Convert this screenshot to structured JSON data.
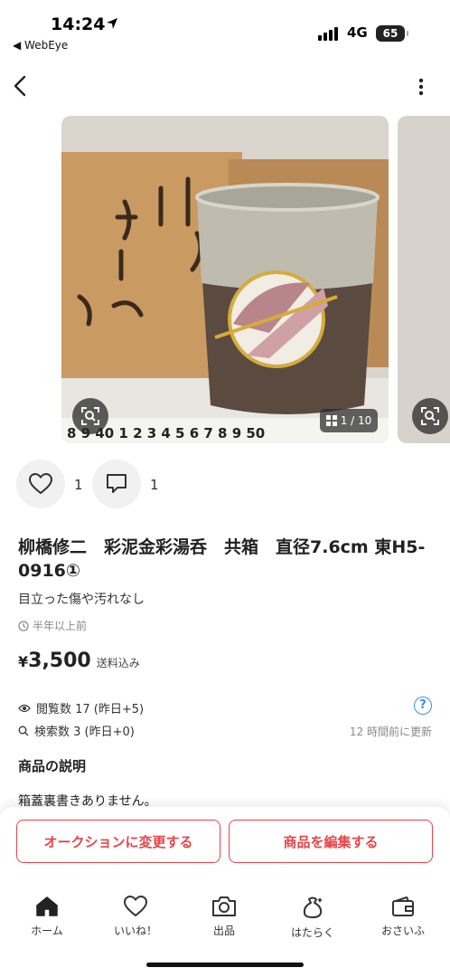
{
  "status_bar": {
    "time": "14:24",
    "back_app": "◀ WebEye",
    "network": "4G",
    "battery": "65"
  },
  "gallery": {
    "counter": "1 / 10"
  },
  "reactions": {
    "likes": "1",
    "comments": "1"
  },
  "item": {
    "title": "柳橋修二　彩泥金彩湯呑　共箱　直径7.6cm 東H5-0916①",
    "condition": "目立った傷や汚れなし",
    "posted": "半年以上前",
    "price_symbol": "¥",
    "price": "3,500",
    "shipping": "送料込み",
    "views": "閲覧数  17 (昨日+5)",
    "searches": "検索数  3 (昨日+0)",
    "updated": "12 時間前に更新",
    "help": "?"
  },
  "description": {
    "heading": "商品の説明",
    "text": "箱蓋裏書きありません。"
  },
  "actions": {
    "auction": "オークションに変更する",
    "edit": "商品を編集する"
  },
  "tabs": [
    {
      "label": "ホーム",
      "icon": "home-icon"
    },
    {
      "label": "いいね！",
      "icon": "heart-icon"
    },
    {
      "label": "出品",
      "icon": "camera-icon"
    },
    {
      "label": "はたらく",
      "icon": "money-bag-icon"
    },
    {
      "label": "おさいふ",
      "icon": "wallet-icon"
    }
  ],
  "colors": {
    "accent": "#e8444b",
    "info": "#3a8ee6"
  }
}
